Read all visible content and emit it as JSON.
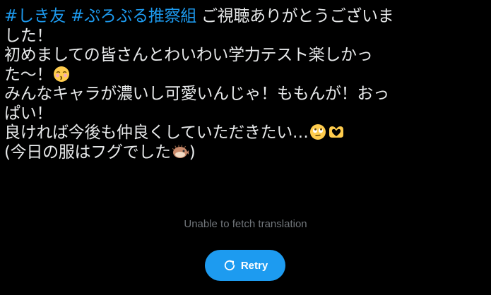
{
  "tweet": {
    "hashtag_1": "#しき友",
    "hashtag_2": "#ぷろぶる推察組",
    "line_1_text": "ご視聴ありがとうございま",
    "line_2": "した！",
    "line_3": "初めましての皆さんとわいわい学力テスト楽しかっ",
    "line_4_text": "た〜！",
    "line_5": "みんなキャラが濃いし可愛いんじゃ！ももんが！おっ",
    "line_6": "ぱい！",
    "line_7_text": "良ければ今後も仲良くしていただきたい…",
    "line_8_open": "(今日の服はフグでした",
    "line_8_close": ")",
    "emojis": [
      "kissing-face-icon",
      "face-with-rolling-eyes-icon",
      "heart-hands-icon",
      "blowfish-icon"
    ]
  },
  "translation": {
    "status": "Unable to fetch translation",
    "retry_label": "Retry"
  },
  "colors": {
    "background": "#000000",
    "text": "#e7e9ea",
    "hashtag": "#1d9bf0",
    "muted": "#71767b",
    "button": "#1d9bf0"
  }
}
